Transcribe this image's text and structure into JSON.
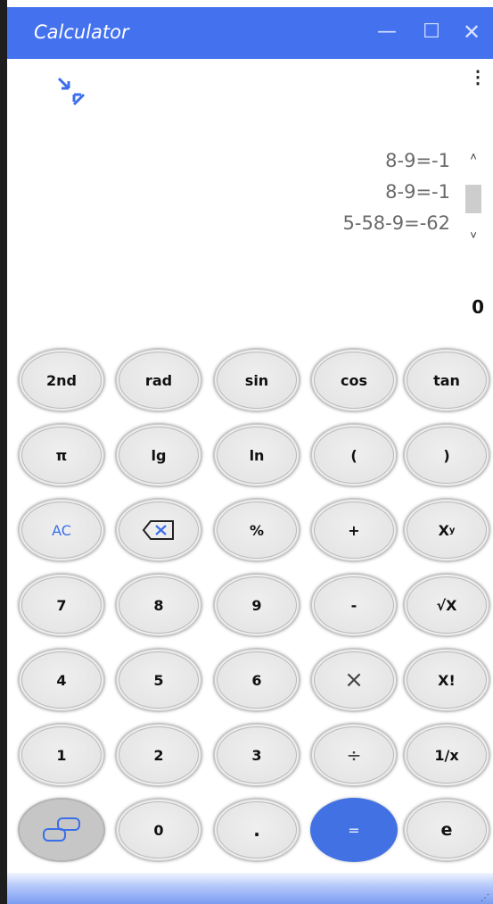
{
  "window": {
    "title": "Calculator",
    "minimize_icon": "—",
    "maximize_icon": "☐",
    "close_icon": "✕"
  },
  "toolbar": {
    "compact_icon": "compact-mode-arrows",
    "menu_icon": "⋮"
  },
  "history": [
    "8-9=-1",
    "8-9=-1",
    "5-58-9=-62"
  ],
  "scroll": {
    "up": "˄",
    "down": "˅"
  },
  "display": {
    "value": "0"
  },
  "keys": {
    "second": "2nd",
    "rad": "rad",
    "sin": "sin",
    "cos": "cos",
    "tan": "tan",
    "pi": "π",
    "lg": "lg",
    "ln": "ln",
    "lparen": "(",
    "rparen": ")",
    "ac": "AC",
    "percent": "%",
    "plus": "+",
    "pow_base": "X",
    "pow_exp": "y",
    "seven": "7",
    "eight": "8",
    "nine": "9",
    "minus": "-",
    "sqrt": "√X",
    "four": "4",
    "five": "5",
    "six": "6",
    "times": "×",
    "fact": "X!",
    "one": "1",
    "two": "2",
    "three": "3",
    "divide": "÷",
    "recip": "1/x",
    "zero": "0",
    "dot": ".",
    "equals": "=",
    "e": "e"
  },
  "colors": {
    "accent": "#4472ee",
    "equals_key": "#4271e4",
    "ac_text": "#3b6fe8"
  }
}
